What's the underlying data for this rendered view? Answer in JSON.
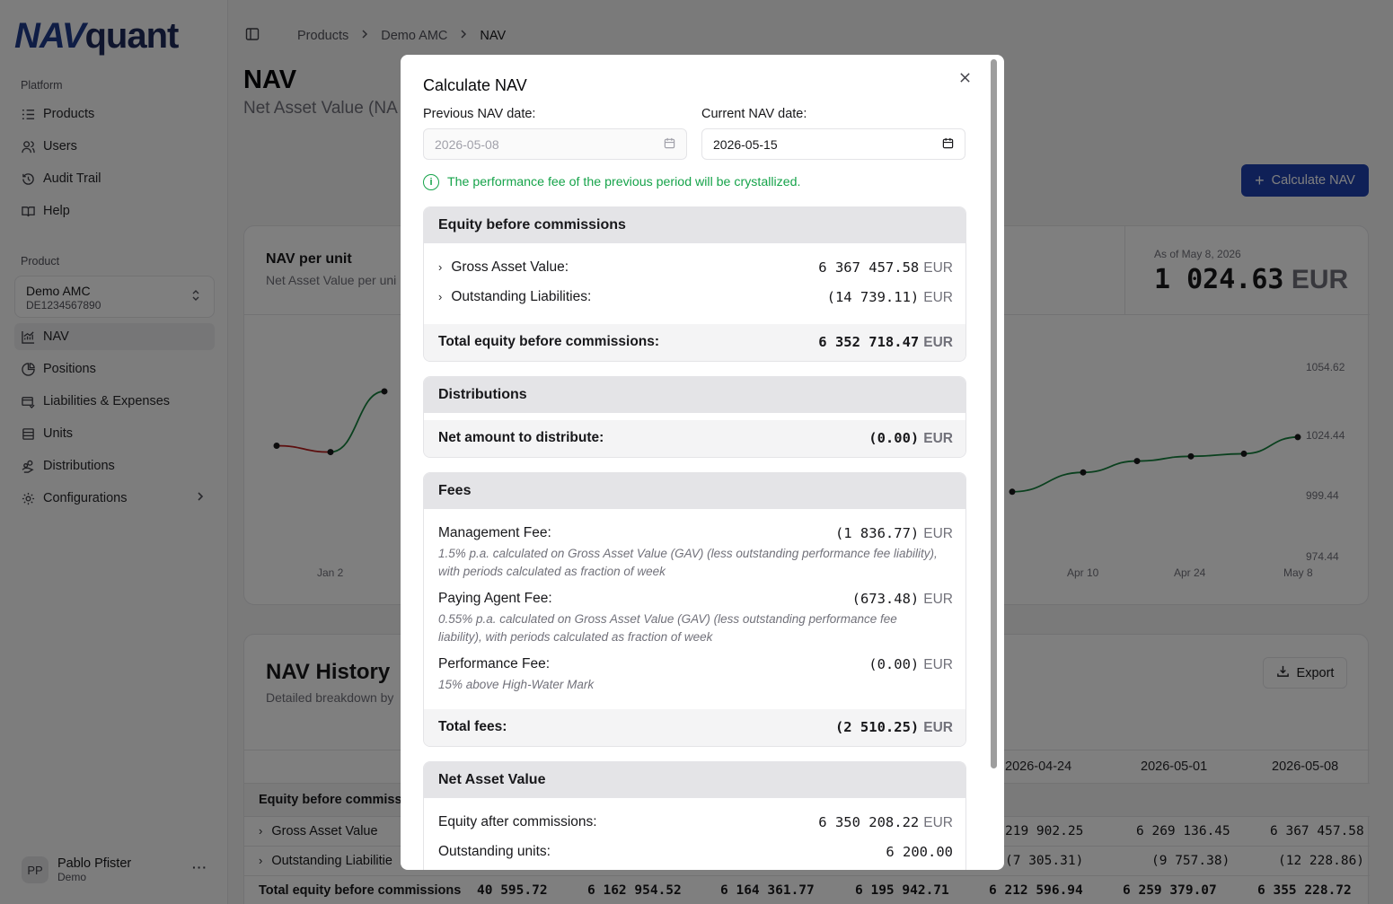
{
  "brand": {
    "logo_nav": "NAV",
    "logo_rest": "quant"
  },
  "sidebar": {
    "platform_label": "Platform",
    "platform_items": [
      {
        "label": "Products",
        "icon": "list-icon"
      },
      {
        "label": "Users",
        "icon": "users-icon"
      },
      {
        "label": "Audit Trail",
        "icon": "history-icon"
      },
      {
        "label": "Help",
        "icon": "book-icon"
      }
    ],
    "product_label": "Product",
    "product_select": {
      "name": "Demo AMC",
      "isin": "DE1234567890"
    },
    "product_items": [
      {
        "label": "NAV",
        "icon": "chart-icon"
      },
      {
        "label": "Positions",
        "icon": "pie-icon"
      },
      {
        "label": "Liabilities & Expenses",
        "icon": "receipt-icon"
      },
      {
        "label": "Units",
        "icon": "stack-icon"
      },
      {
        "label": "Distributions",
        "icon": "hand-coins-icon"
      },
      {
        "label": "Configurations",
        "icon": "gear-icon"
      }
    ],
    "user": {
      "initials": "PP",
      "name": "Pablo Pfister",
      "role": "Demo",
      "more": "···"
    }
  },
  "breadcrumb": [
    "Products",
    "Demo AMC",
    "NAV"
  ],
  "page": {
    "title": "NAV",
    "subtitle": "Net Asset Value (NA",
    "calc_button": "Calculate NAV"
  },
  "nav_card": {
    "title": "NAV per unit",
    "subtitle": "Net Asset Value per uni",
    "asof_label": "As of May 8, 2026",
    "asof_value": "1 024.63",
    "asof_currency": "EUR"
  },
  "chart_data": {
    "type": "line",
    "series": [
      {
        "values_left": [
          1021.0,
          1018.3,
          1044.0
        ],
        "x_left": [
          "",
          "Jan 2",
          ""
        ]
      },
      {
        "values_right": [
          1001.5,
          1009.7,
          1014.5,
          1016.5,
          1017.6,
          1024.63
        ],
        "x_right": [
          "",
          "Apr 10",
          "",
          "Apr 24",
          "",
          "May 8"
        ]
      }
    ],
    "y_ticks": [
      "1054.62",
      "1024.44",
      "999.44",
      "974.44"
    ],
    "x_ticks_visible": [
      "Jan 2",
      "Apr 10",
      "Apr 24",
      "May 8"
    ],
    "colors": {
      "down": "#b91c1c",
      "up": "#15803d"
    }
  },
  "history": {
    "title": "NAV History",
    "subtitle": "Detailed breakdown by",
    "export": "Export",
    "columns": [
      "2026-04-24",
      "2026-05-01",
      "2026-05-08"
    ],
    "section": "Equity before commiss",
    "rows": [
      {
        "label": "Gross Asset Value",
        "values": [
          "219 902.25",
          "6 269 136.45",
          "6 367 457.58"
        ]
      },
      {
        "label": "Outstanding Liabilitie",
        "values": [
          "(7 305.31)",
          "(9 757.38)",
          "(12 228.86)"
        ]
      }
    ],
    "total_row": {
      "label": "Total equity before commissions",
      "values": [
        "40 595.72",
        "6 162 954.52",
        "6 164 361.77",
        "6 195 942.71",
        "6 212 596.94",
        "6 259 379.07",
        "6 355 228.72"
      ]
    }
  },
  "modal": {
    "title": "Calculate NAV",
    "close": "×",
    "prev_label": "Previous NAV date:",
    "prev_value": "2026-05-08",
    "curr_label": "Current NAV date:",
    "curr_value": "2026-05-15",
    "notice": "The performance fee of the previous period will be crystallized.",
    "currency": "EUR",
    "equity": {
      "header": "Equity before commissions",
      "gav_label": "Gross Asset Value:",
      "gav_value": "6 367 457.58",
      "liab_label": "Outstanding Liabilities:",
      "liab_value": "(14 739.11)",
      "total_label": "Total equity before commissions:",
      "total_value": "6 352 718.47"
    },
    "distributions": {
      "header": "Distributions",
      "net_label": "Net amount to distribute:",
      "net_value": "(0.00)"
    },
    "fees": {
      "header": "Fees",
      "mgmt_label": "Management Fee:",
      "mgmt_value": "(1 836.77)",
      "mgmt_desc": "1.5% p.a. calculated on Gross Asset Value (GAV) (less outstanding performance fee liability), with periods calculated as fraction of week",
      "pay_label": "Paying Agent Fee:",
      "pay_value": "(673.48)",
      "pay_desc": "0.55% p.a. calculated on Gross Asset Value (GAV) (less outstanding performance fee liability), with periods calculated as fraction of week",
      "perf_label": "Performance Fee:",
      "perf_value": "(0.00)",
      "perf_desc": "15% above High-Water Mark",
      "total_label": "Total fees:",
      "total_value": "(2 510.25)"
    },
    "nav": {
      "header": "Net Asset Value",
      "eq_label": "Equity after commissions:",
      "eq_value": "6 350 208.22",
      "units_label": "Outstanding units:",
      "units_value": "6 200.00"
    }
  }
}
